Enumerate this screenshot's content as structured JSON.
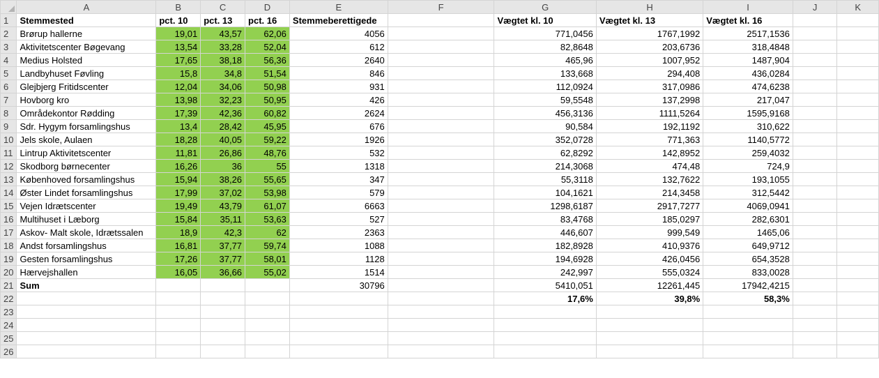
{
  "spreadsheet": {
    "columns": [
      "A",
      "B",
      "C",
      "D",
      "E",
      "F",
      "G",
      "H",
      "I",
      "J",
      "K"
    ],
    "header_row": {
      "stemmested": "Stemmested",
      "pct10": "pct. 10",
      "pct13": "pct. 13",
      "pct16": "pct. 16",
      "stemmeberettigede": "Stemmeberettigede",
      "f": "",
      "vaegtet10": "Vægtet kl. 10",
      "vaegtet13": "Vægtet kl. 13",
      "vaegtet16": "Vægtet kl. 16"
    },
    "rows": [
      {
        "num": "2",
        "a": "Brørup hallerne",
        "b": "19,01",
        "c": "43,57",
        "d": "62,06",
        "e": "4056",
        "g": "771,0456",
        "h": "1767,1992",
        "i": "2517,1536"
      },
      {
        "num": "3",
        "a": "Aktivitetscenter Bøgevang",
        "b": "13,54",
        "c": "33,28",
        "d": "52,04",
        "e": "612",
        "g": "82,8648",
        "h": "203,6736",
        "i": "318,4848"
      },
      {
        "num": "4",
        "a": "Medius Holsted",
        "b": "17,65",
        "c": "38,18",
        "d": "56,36",
        "e": "2640",
        "g": "465,96",
        "h": "1007,952",
        "i": "1487,904"
      },
      {
        "num": "5",
        "a": "Landbyhuset Føvling",
        "b": "15,8",
        "c": "34,8",
        "d": "51,54",
        "e": "846",
        "g": "133,668",
        "h": "294,408",
        "i": "436,0284"
      },
      {
        "num": "6",
        "a": "Glejbjerg Fritidscenter",
        "b": "12,04",
        "c": "34,06",
        "d": "50,98",
        "e": "931",
        "g": "112,0924",
        "h": "317,0986",
        "i": "474,6238"
      },
      {
        "num": "7",
        "a": "Hovborg kro",
        "b": "13,98",
        "c": "32,23",
        "d": "50,95",
        "e": "426",
        "g": "59,5548",
        "h": "137,2998",
        "i": "217,047"
      },
      {
        "num": "8",
        "a": "Områdekontor Rødding",
        "b": "17,39",
        "c": "42,36",
        "d": "60,82",
        "e": "2624",
        "g": "456,3136",
        "h": "1111,5264",
        "i": "1595,9168"
      },
      {
        "num": "9",
        "a": "Sdr. Hygym forsamlingshus",
        "b": "13,4",
        "c": "28,42",
        "d": "45,95",
        "e": "676",
        "g": "90,584",
        "h": "192,1192",
        "i": "310,622"
      },
      {
        "num": "10",
        "a": "Jels skole, Aulaen",
        "b": "18,28",
        "c": "40,05",
        "d": "59,22",
        "e": "1926",
        "g": "352,0728",
        "h": "771,363",
        "i": "1140,5772"
      },
      {
        "num": "11",
        "a": "Lintrup Aktivitetscenter",
        "b": "11,81",
        "c": "26,86",
        "d": "48,76",
        "e": "532",
        "g": "62,8292",
        "h": "142,8952",
        "i": "259,4032"
      },
      {
        "num": "12",
        "a": "Skodborg børnecenter",
        "b": "16,26",
        "c": "36",
        "d": "55",
        "e": "1318",
        "g": "214,3068",
        "h": "474,48",
        "i": "724,9"
      },
      {
        "num": "13",
        "a": "Københoved forsamlingshus",
        "b": "15,94",
        "c": "38,26",
        "d": "55,65",
        "e": "347",
        "g": "55,3118",
        "h": "132,7622",
        "i": "193,1055"
      },
      {
        "num": "14",
        "a": "Øster Lindet forsamlingshus",
        "b": "17,99",
        "c": "37,02",
        "d": "53,98",
        "e": "579",
        "g": "104,1621",
        "h": "214,3458",
        "i": "312,5442"
      },
      {
        "num": "15",
        "a": "Vejen Idrætscenter",
        "b": "19,49",
        "c": "43,79",
        "d": "61,07",
        "e": "6663",
        "g": "1298,6187",
        "h": "2917,7277",
        "i": "4069,0941"
      },
      {
        "num": "16",
        "a": "Multihuset i Læborg",
        "b": "15,84",
        "c": "35,11",
        "d": "53,63",
        "e": "527",
        "g": "83,4768",
        "h": "185,0297",
        "i": "282,6301"
      },
      {
        "num": "17",
        "a": "Askov- Malt skole, Idrætssalen",
        "b": "18,9",
        "c": "42,3",
        "d": "62",
        "e": "2363",
        "g": "446,607",
        "h": "999,549",
        "i": "1465,06"
      },
      {
        "num": "18",
        "a": "Andst forsamlingshus",
        "b": "16,81",
        "c": "37,77",
        "d": "59,74",
        "e": "1088",
        "g": "182,8928",
        "h": "410,9376",
        "i": "649,9712"
      },
      {
        "num": "19",
        "a": "Gesten forsamlingshus",
        "b": "17,26",
        "c": "37,77",
        "d": "58,01",
        "e": "1128",
        "g": "194,6928",
        "h": "426,0456",
        "i": "654,3528"
      },
      {
        "num": "20",
        "a": "Hærvejshallen",
        "b": "16,05",
        "c": "36,66",
        "d": "55,02",
        "e": "1514",
        "g": "242,997",
        "h": "555,0324",
        "i": "833,0028"
      }
    ],
    "sum_row": {
      "num": "21",
      "a": "Sum",
      "e": "30796",
      "g": "5410,051",
      "h": "12261,445",
      "i": "17942,4215"
    },
    "pct_row": {
      "num": "22",
      "g": "17,6%",
      "h": "39,8%",
      "i": "58,3%"
    },
    "empty_rows": [
      "23",
      "24",
      "25",
      "26"
    ],
    "header_row_num": "1",
    "highlight_color": "#92d050"
  }
}
